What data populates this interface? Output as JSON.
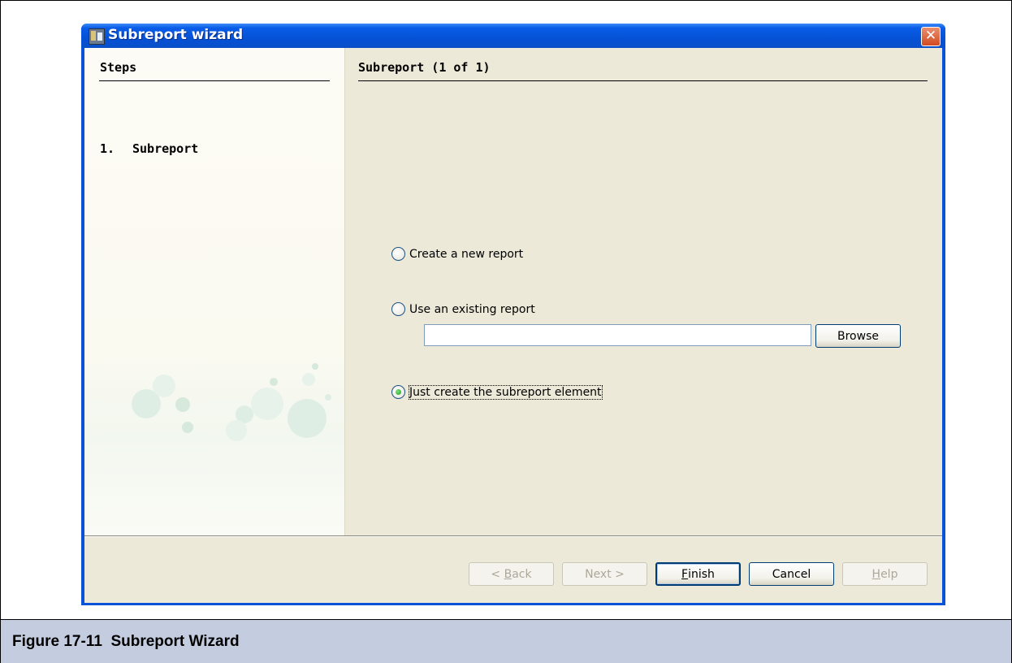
{
  "window": {
    "title": "Subreport wizard",
    "close_glyph": "✕"
  },
  "steps": {
    "header": "Steps",
    "items": [
      {
        "number": "1.",
        "label": "Subreport"
      }
    ]
  },
  "panel": {
    "title": "Subreport (1 of 1)",
    "options": [
      {
        "label": "Create a new report",
        "selected": false
      },
      {
        "label": "Use an existing report",
        "selected": false
      },
      {
        "label": "Just create the subreport element",
        "selected": true
      }
    ],
    "report_path": {
      "value": "",
      "placeholder": ""
    },
    "browse_label": "Browse"
  },
  "footer": {
    "back": {
      "prefix": "< ",
      "mnemonic": "B",
      "rest": "ack",
      "enabled": false
    },
    "next": {
      "label": "Next >",
      "enabled": false
    },
    "finish": {
      "mnemonic": "F",
      "rest": "inish",
      "enabled": true
    },
    "cancel": {
      "label": "Cancel",
      "enabled": true
    },
    "help": {
      "mnemonic": "H",
      "rest": "elp",
      "enabled": false
    }
  },
  "caption": {
    "text": "Figure 17-11  Subreport Wizard",
    "background": "#c4cce0"
  },
  "colors": {
    "title_bar": "#0552d6",
    "dialog_bg": "#ece9d8",
    "radio_selected": "#21a121"
  }
}
